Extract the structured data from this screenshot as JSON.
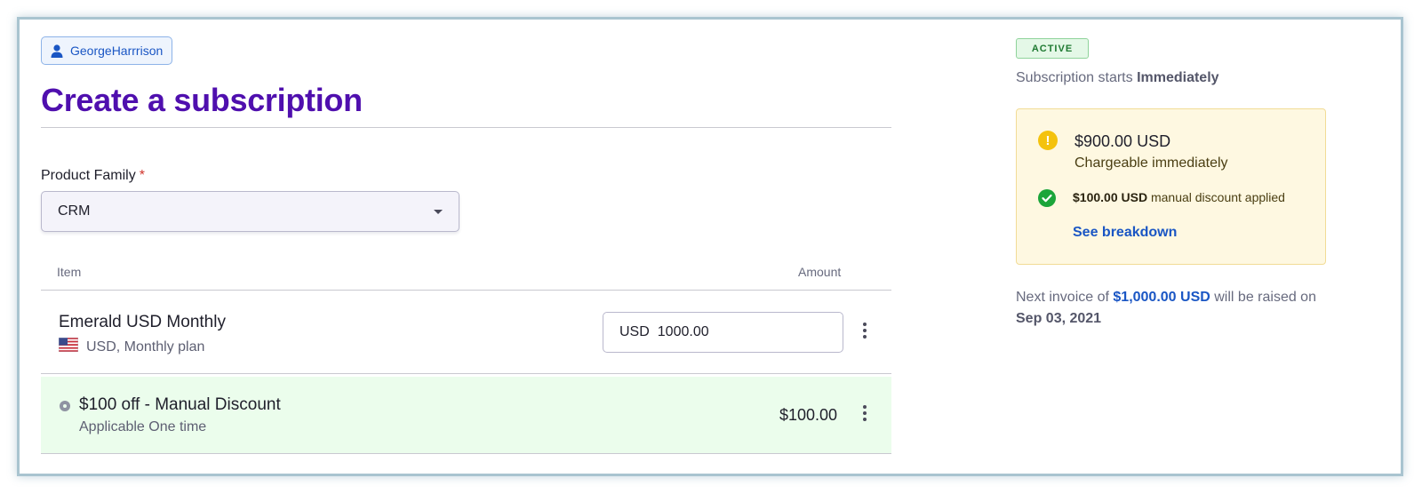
{
  "user": {
    "name": "GeorgeHarrrison",
    "icon": "user-icon"
  },
  "page": {
    "title": "Create a subscription"
  },
  "form": {
    "product_family_label": "Product Family",
    "required_marker": "*",
    "product_family_value": "CRM"
  },
  "table": {
    "col_item": "Item",
    "col_amount": "Amount"
  },
  "plan": {
    "name": "Emerald USD Monthly",
    "sub": "USD, Monthly plan",
    "flag_icon": "us-flag-icon",
    "currency": "USD",
    "amount": "1000.00"
  },
  "discount": {
    "name": "$100 off - Manual Discount",
    "sub": "Applicable One time",
    "amount": "$100.00"
  },
  "sidebar": {
    "status": "ACTIVE",
    "starts_prefix": "Subscription starts",
    "starts_value": "Immediately",
    "charge_amount": "$900.00 USD",
    "charge_sub": "Chargeable immediately",
    "discount_amount": "$100.00 USD",
    "discount_text": "manual discount applied",
    "breakdown_link": "See breakdown",
    "next_prefix": "Next invoice of",
    "next_amount": "$1,000.00 USD",
    "next_mid": "will be raised on",
    "next_date": "Sep 03, 2021"
  },
  "colors": {
    "title": "#4f0fae",
    "link": "#1a56c4",
    "discount_bg": "#ebfdec",
    "warning_bg": "#fef8e1",
    "active_badge": "#1f7a32"
  }
}
